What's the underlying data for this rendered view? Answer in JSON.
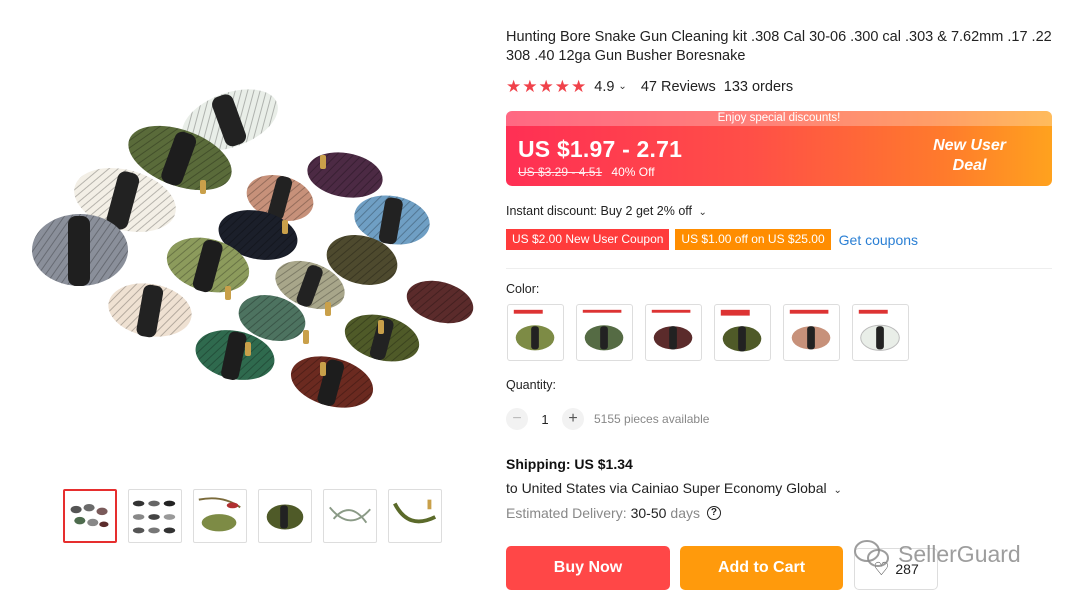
{
  "product": {
    "title": "Hunting Bore Snake Gun Cleaning kit .308 Cal 30-06 .300 cal .303 & 7.62mm .17 .22 308 .40 12ga Gun Busher Boresnake",
    "rating": "4.9",
    "reviews": "47 Reviews",
    "orders": "133 orders"
  },
  "price": {
    "banner_top": "Enjoy special discounts!",
    "current": "US $1.97 - 2.71",
    "original": "US $3.29 - 4.51",
    "discount": "40% Off",
    "badge_line1": "New User",
    "badge_line2": "Deal"
  },
  "promo": {
    "instant_discount": "Instant discount: Buy 2 get 2% off",
    "coupon_1": "US $2.00 New User Coupon",
    "coupon_2": "US $1.00 off on US $25.00",
    "get_coupons": "Get coupons"
  },
  "color": {
    "label": "Color:"
  },
  "quantity": {
    "label": "Quantity:",
    "value": "1",
    "minus": "−",
    "plus": "+",
    "available": "5155 pieces available"
  },
  "shipping": {
    "title": "Shipping: US $1.34",
    "destination": "to United States via Cainiao Super Economy Global",
    "estimated_label": "Estimated Delivery:",
    "estimated_value": "30-50",
    "estimated_unit": "days"
  },
  "actions": {
    "buy_now": "Buy Now",
    "add_to_cart": "Add to Cart",
    "wishlist_count": "287"
  },
  "watermark": "SellerGuard",
  "colors": {
    "accent_red": "#ff4747",
    "accent_orange": "#ff9a0c",
    "star": "#f0424a",
    "link": "#2a7fd4"
  }
}
